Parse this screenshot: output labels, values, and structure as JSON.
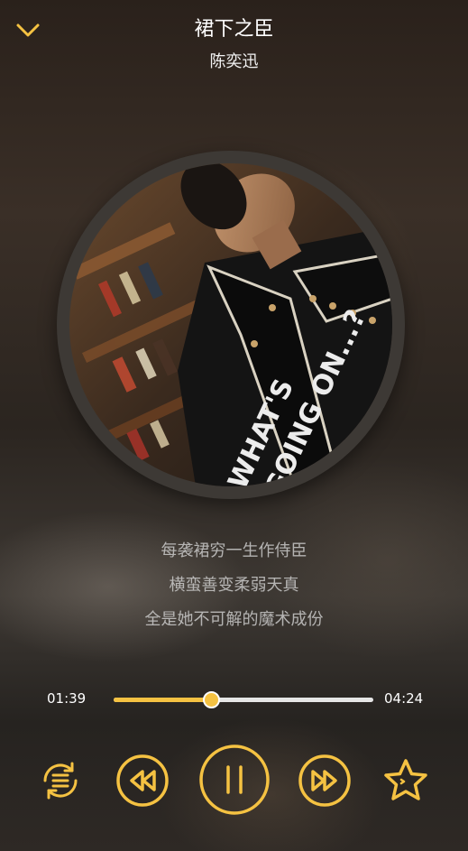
{
  "header": {
    "title": "裙下之臣",
    "artist": "陈奕迅",
    "back_icon": "chevron-down-icon"
  },
  "cover": {
    "shirt_text_line1": "WHAT'S",
    "shirt_text_line2": "GOING ON...?"
  },
  "lyrics": {
    "lines": [
      "每袭裙穷一生作侍臣",
      "横蛮善变柔弱天真",
      "全是她不可解的魔术成份"
    ]
  },
  "progress": {
    "current_time": "01:39",
    "total_time": "04:24",
    "fraction": 0.375
  },
  "controls": {
    "playlist_icon": "playlist-loop-icon",
    "previous_icon": "rewind-icon",
    "pause_icon": "pause-icon",
    "next_icon": "fast-forward-icon",
    "favorite_icon": "star-icon"
  },
  "colors": {
    "accent": "#f5c242",
    "text": "#ffffff",
    "track": "#e6e6e6"
  }
}
